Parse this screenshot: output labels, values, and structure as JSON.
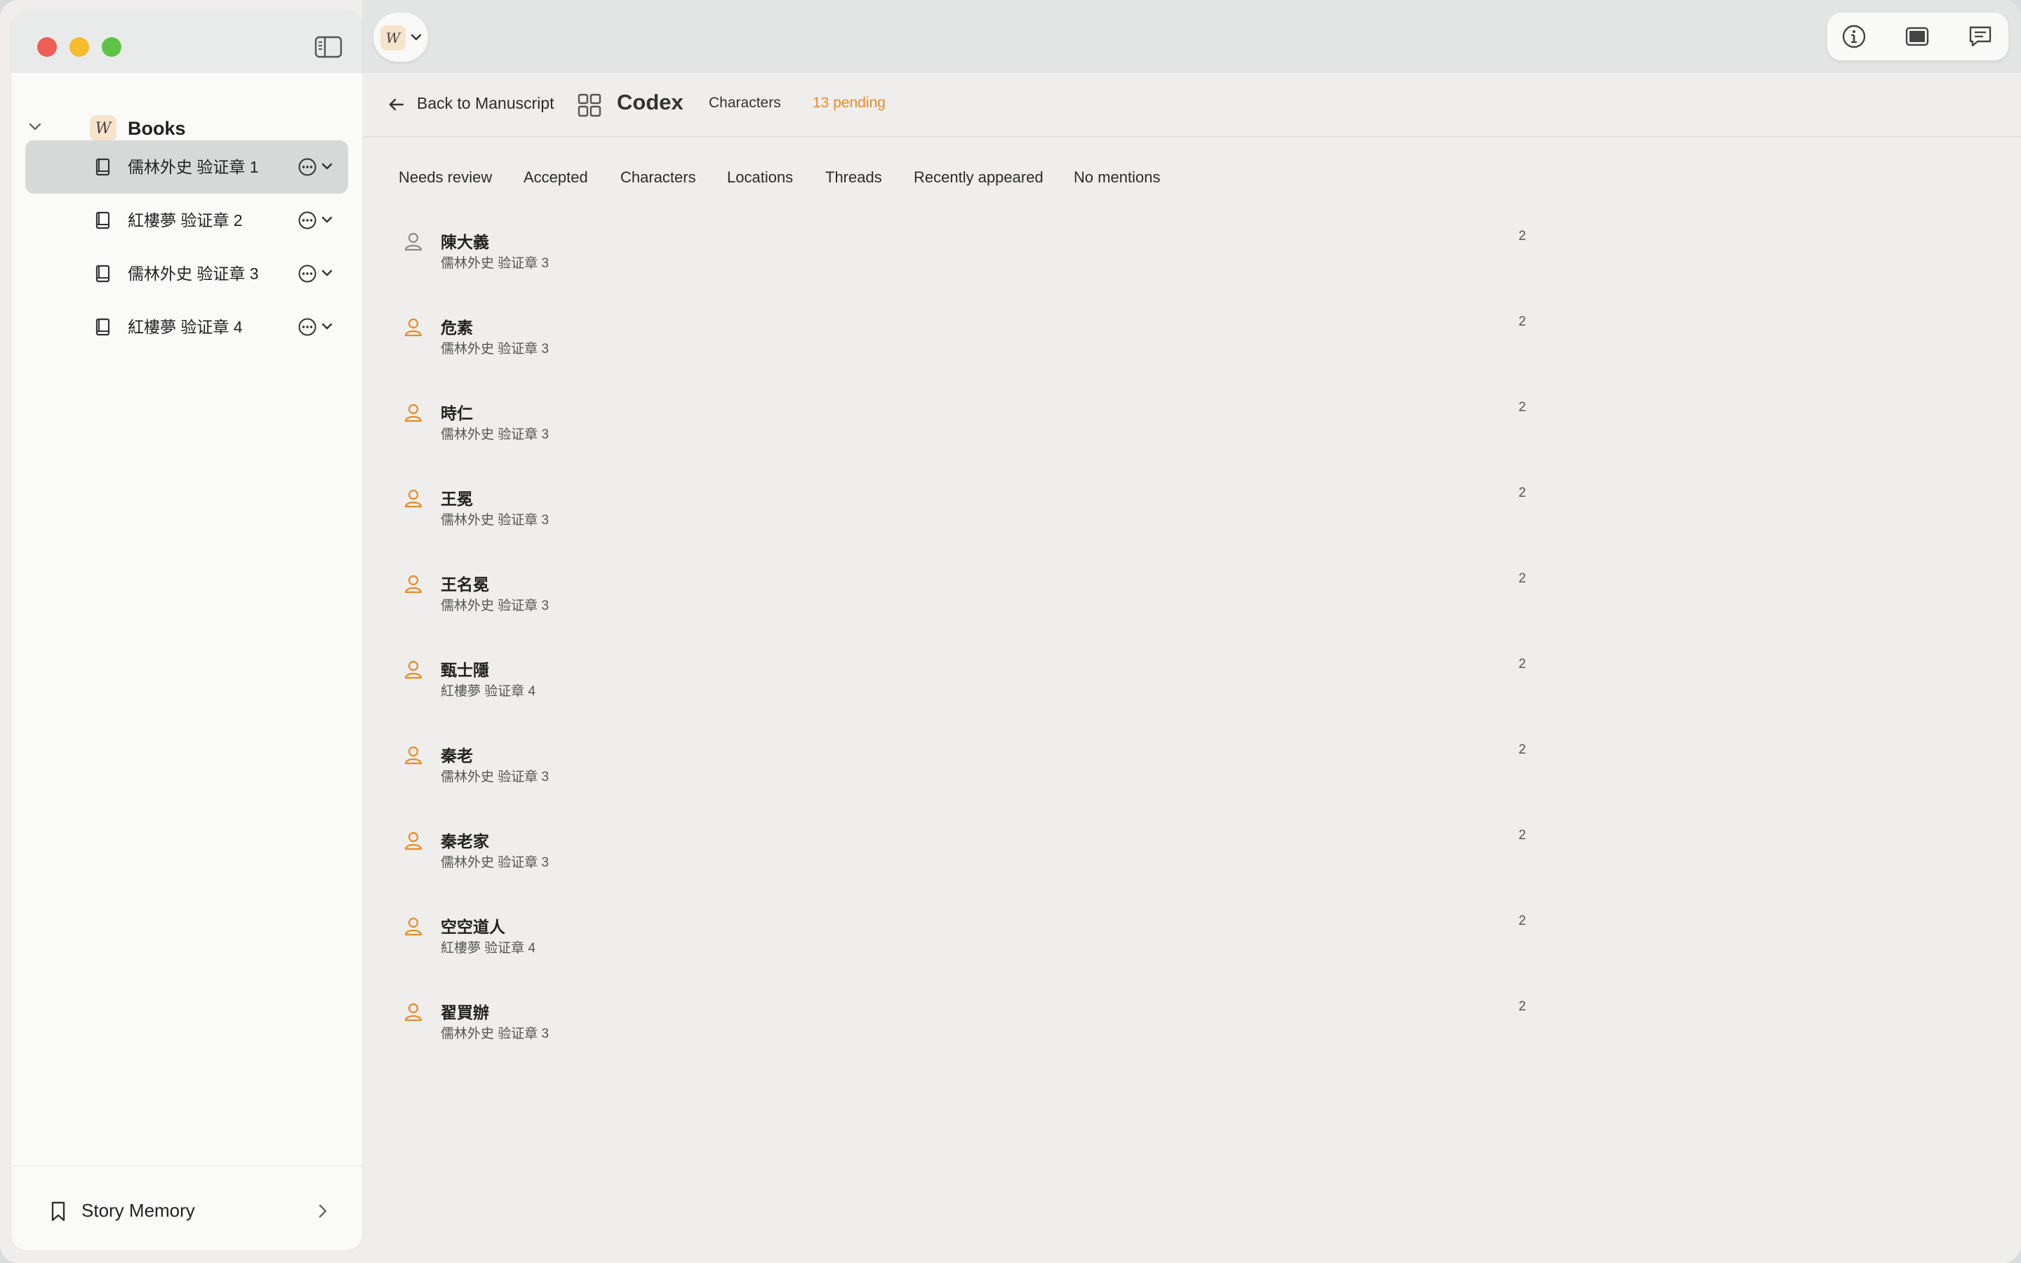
{
  "sidebar": {
    "tree_title": "Books",
    "books": [
      {
        "label": "儒林外史 验证章 1"
      },
      {
        "label": "紅樓夢 验证章 2"
      },
      {
        "label": "儒林外史 验证章 3"
      },
      {
        "label": "紅樓夢 验证章 4"
      }
    ],
    "footer_label": "Story Memory",
    "logo_glyph": "W"
  },
  "header": {
    "back_label": "Back to Manuscript",
    "title": "Codex",
    "crumb": "Characters",
    "pending": "13 pending"
  },
  "tabs": [
    "Needs review",
    "Accepted",
    "Characters",
    "Locations",
    "Threads",
    "Recently appeared",
    "No mentions"
  ],
  "entries": [
    {
      "name": "陳大義",
      "source": "儒林外史 验证章 3",
      "count": "2",
      "status": "gray"
    },
    {
      "name": "危素",
      "source": "儒林外史 验证章 3",
      "count": "2",
      "status": "orange"
    },
    {
      "name": "時仁",
      "source": "儒林外史 验证章 3",
      "count": "2",
      "status": "orange"
    },
    {
      "name": "王冕",
      "source": "儒林外史 验证章 3",
      "count": "2",
      "status": "orange"
    },
    {
      "name": "王名冕",
      "source": "儒林外史 验证章 3",
      "count": "2",
      "status": "orange"
    },
    {
      "name": "甄士隱",
      "source": "紅樓夢 验证章 4",
      "count": "2",
      "status": "orange"
    },
    {
      "name": "秦老",
      "source": "儒林外史 验证章 3",
      "count": "2",
      "status": "orange"
    },
    {
      "name": "秦老家",
      "source": "儒林外史 验证章 3",
      "count": "2",
      "status": "orange"
    },
    {
      "name": "空空道人",
      "source": "紅樓夢 验证章 4",
      "count": "2",
      "status": "orange"
    },
    {
      "name": "翟買辦",
      "source": "儒林外史 验证章 3",
      "count": "2",
      "status": "orange"
    }
  ],
  "colors": {
    "accent": "#e98a27",
    "gray_icon": "#8a8a8a"
  },
  "icons": [
    "sidebar-toggle-icon",
    "info-icon",
    "display-icon",
    "comment-icon",
    "book-icon",
    "more-icon",
    "bookmark-icon",
    "person-icon",
    "grid-icon",
    "back-arrow-icon"
  ]
}
